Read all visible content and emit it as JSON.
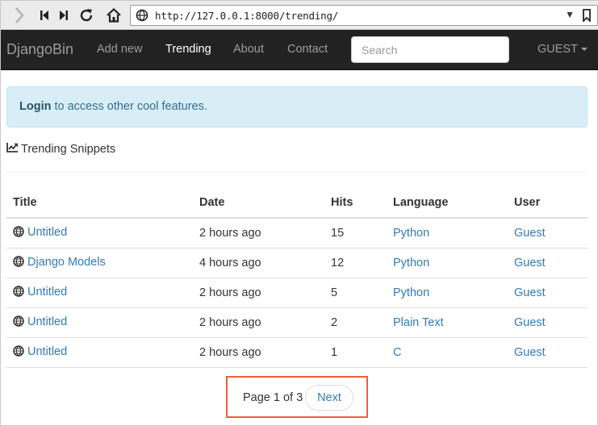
{
  "browser": {
    "url": "http://127.0.0.1:8000/trending/"
  },
  "navbar": {
    "brand": "DjangoBin",
    "links": [
      "Add new",
      "Trending",
      "About",
      "Contact"
    ],
    "active_link": "Trending",
    "search_placeholder": "Search",
    "user_label": "GUEST"
  },
  "alert": {
    "login_label": "Login",
    "message": " to access other cool features."
  },
  "section": {
    "title": "Trending Snippets",
    "icon": "line-chart-icon"
  },
  "table": {
    "headers": [
      "Title",
      "Date",
      "Hits",
      "Language",
      "User"
    ],
    "rows": [
      {
        "title": "Untitled",
        "date": "2 hours ago",
        "hits": "15",
        "language": "Python",
        "user": "Guest"
      },
      {
        "title": "Django Models",
        "date": "4 hours ago",
        "hits": "12",
        "language": "Python",
        "user": "Guest"
      },
      {
        "title": "Untitled",
        "date": "2 hours ago",
        "hits": "5",
        "language": "Python",
        "user": "Guest"
      },
      {
        "title": "Untitled",
        "date": "2 hours ago",
        "hits": "2",
        "language": "Plain Text",
        "user": "Guest"
      },
      {
        "title": "Untitled",
        "date": "2 hours ago",
        "hits": "1",
        "language": "C",
        "user": "Guest"
      }
    ],
    "row_icon": "globe-icon"
  },
  "pagination": {
    "status": "Page 1 of 3",
    "next_label": "Next"
  },
  "colors": {
    "navbar_bg": "#222222",
    "link": "#337ab7",
    "alert_bg": "#d9edf7",
    "highlight_border": "#e8603c"
  }
}
